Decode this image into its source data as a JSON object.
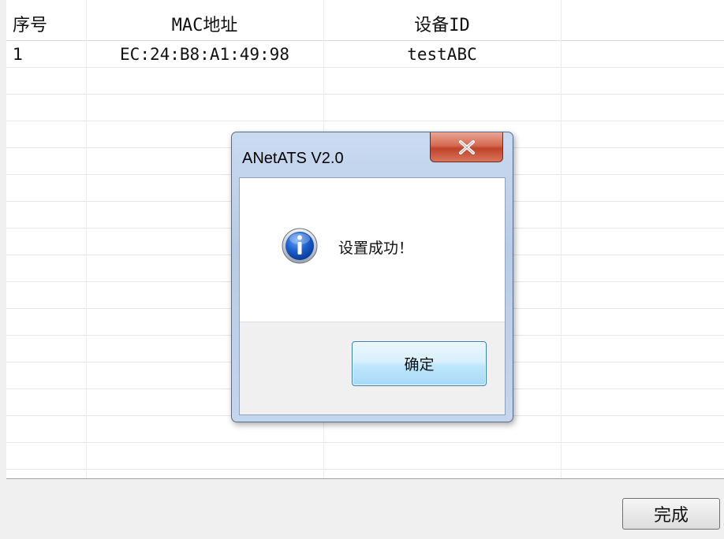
{
  "table": {
    "headers": [
      "序号",
      "MAC地址",
      "设备ID",
      ""
    ],
    "rows": [
      [
        "1",
        "EC:24:B8:A1:49:98",
        "testABC",
        ""
      ]
    ]
  },
  "bottom_bar": {
    "done_label": "完成"
  },
  "dialog": {
    "title": "ANetATS V2.0",
    "close_icon": "close-icon",
    "icon": "info-icon",
    "message": "设置成功！",
    "ok_label": "确定"
  }
}
